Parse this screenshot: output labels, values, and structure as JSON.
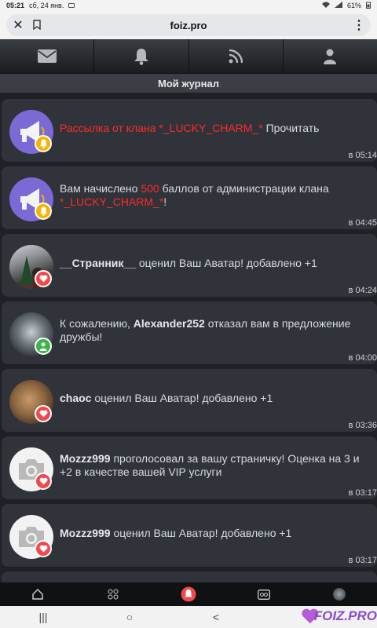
{
  "status": {
    "time": "05:21",
    "date": "сб, 24 янв.",
    "battery": "61%"
  },
  "browser": {
    "url": "foiz.pro"
  },
  "nav": {
    "items": [
      "mail-icon",
      "bell-icon",
      "rss-icon",
      "user-icon"
    ]
  },
  "page": {
    "title": "Мой журнал"
  },
  "feed": [
    {
      "text_red": "Рассылка от клана *_LUCKY_CHARM_*",
      "text_rest": " Прочитать",
      "time": "в 05:14",
      "avatar": "megaphone",
      "badge": "bell"
    },
    {
      "pre": "Вам начислено ",
      "amount": "500",
      "mid": " баллов от администрации клана ",
      "clan": "*_LUCKY_CHARM_*",
      "end": "!",
      "time": "в 04:45",
      "avatar": "megaphone",
      "badge": "bell"
    },
    {
      "user": "__Странник__",
      "rest": " оценил Ваш Аватар! добавлено +1",
      "time": "в 04:24",
      "avatar": "photo-tree",
      "badge": "heart"
    },
    {
      "pre": "К сожалению, ",
      "user": "Alexander252",
      "rest": " отказал вам в предложение дружбы!",
      "time": "в 04:00",
      "avatar": "photo-clouds",
      "badge": "person"
    },
    {
      "user": "chaoc",
      "rest": " оценил Ваш Аватар! добавлено +1",
      "time": "в 03:36",
      "avatar": "photo-dog",
      "badge": "heart"
    },
    {
      "user": "Mozzz999",
      "rest": " проголосовал за вашу страничку! Оценка на 3 и +2 в качестве вашей VIP услуги",
      "time": "в 03:17",
      "avatar": "camera",
      "badge": "heart"
    },
    {
      "user": "Mozzz999",
      "rest": " оценил Ваш Аватар! добавлено +1",
      "time": "в 03:17",
      "avatar": "camera",
      "badge": "heart"
    }
  ],
  "colors": {
    "accent_red": "#ff2a2a",
    "badge_heart": "#f0494b",
    "badge_bell": "#f5b400",
    "badge_person": "#3cb44b",
    "megaphone_bg": "#7b69d6"
  },
  "bottom_nav": [
    "home-icon",
    "apps-icon",
    "notify-icon",
    "cc-icon",
    "avatar"
  ],
  "system_nav": {
    "recents": "|||",
    "home": "○",
    "back": "<"
  },
  "logo": {
    "text": "FOIZ.PRO"
  }
}
